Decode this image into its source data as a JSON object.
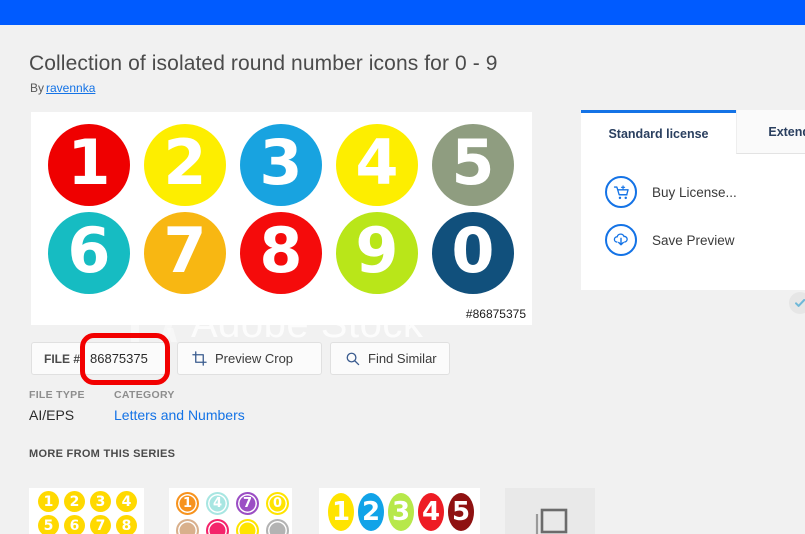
{
  "topbar": {
    "color": "#005bff"
  },
  "header": {
    "title": "Collection of isolated round number icons for 0 - 9",
    "by_prefix": "By",
    "author": "ravennka"
  },
  "preview": {
    "file_id_label": "#86875375",
    "watermark_text": "Adobe Stock",
    "watermark_logo": "adobe-stock-logo",
    "numbers": [
      {
        "digit": "1",
        "color": "#ef0000"
      },
      {
        "digit": "2",
        "color": "#fdee00"
      },
      {
        "digit": "3",
        "color": "#18a3e0"
      },
      {
        "digit": "4",
        "color": "#fdee00"
      },
      {
        "digit": "5",
        "color": "#8f9d80"
      },
      {
        "digit": "6",
        "color": "#16bcc2"
      },
      {
        "digit": "7",
        "color": "#f8b712"
      },
      {
        "digit": "8",
        "color": "#f50b0b"
      },
      {
        "digit": "9",
        "color": "#b9e619"
      },
      {
        "digit": "0",
        "color": "#11507c"
      }
    ]
  },
  "license_panel": {
    "tabs": [
      {
        "label": "Standard license",
        "active": true
      },
      {
        "label": "Extended",
        "active": false
      }
    ],
    "actions": [
      {
        "label": "Buy License...",
        "icon": "shopping-cart-icon"
      },
      {
        "label": "Save Preview",
        "icon": "cloud-download-icon"
      }
    ],
    "badge_icon": "checkmark-circle-icon",
    "accent_color": "#1473e6"
  },
  "actionbar": {
    "file_number_key": "FILE #:",
    "file_number_value": "86875375",
    "preview_crop_label": "Preview Crop",
    "preview_crop_icon": "crop-icon",
    "find_similar_label": "Find Similar",
    "find_similar_icon": "search-icon",
    "annotation_color": "#f20000"
  },
  "meta": {
    "file_type_label": "FILE TYPE",
    "file_type_value": "AI/EPS",
    "category_label": "CATEGORY",
    "category_value": "Letters and Numbers"
  },
  "series": {
    "heading": "MORE FROM THIS SERIES",
    "thumbs": [
      {
        "name": "yellow-number-set",
        "style": "grid8",
        "items": [
          {
            "digit": "1",
            "color": "#ffd900"
          },
          {
            "digit": "2",
            "color": "#ffd900"
          },
          {
            "digit": "3",
            "color": "#ffd900"
          },
          {
            "digit": "4",
            "color": "#ffd900"
          },
          {
            "digit": "5",
            "color": "#ffd900"
          },
          {
            "digit": "6",
            "color": "#ffd900"
          },
          {
            "digit": "7",
            "color": "#ffd900"
          },
          {
            "digit": "8",
            "color": "#ffd900"
          }
        ]
      },
      {
        "name": "pastel-ring-number-set",
        "style": "grid8ring",
        "items": [
          {
            "digit": "1",
            "color": "#f7931e"
          },
          {
            "digit": "4",
            "color": "#a8e6e2"
          },
          {
            "digit": "7",
            "color": "#9b4ec4"
          },
          {
            "digit": "0",
            "color": "#ffe400"
          },
          {
            "digit": "",
            "color": "#d9b08c"
          },
          {
            "digit": "",
            "color": "#f4256b"
          },
          {
            "digit": "",
            "color": "#ffe400"
          },
          {
            "digit": "",
            "color": "#b3b3b3"
          }
        ]
      },
      {
        "name": "glossy-oval-number-set",
        "style": "ovals",
        "items": [
          {
            "digit": "1",
            "color": "#ffe400"
          },
          {
            "digit": "2",
            "color": "#11a3e8"
          },
          {
            "digit": "3",
            "color": "#b7e84a"
          },
          {
            "digit": "4",
            "color": "#ee1c24"
          },
          {
            "digit": "5",
            "color": "#8f1111"
          }
        ]
      },
      {
        "name": "image-placeholder",
        "style": "placeholder",
        "items": []
      }
    ]
  }
}
